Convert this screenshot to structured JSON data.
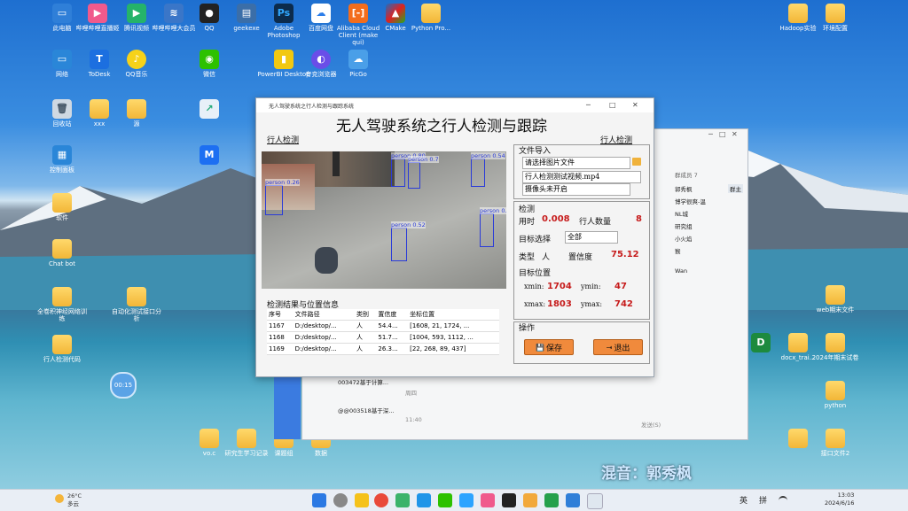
{
  "desktop": {
    "icons_top": [
      "此电脑",
      "哔哩哔哩直播姬",
      "腾讯视频",
      "哔哩哔哩大会员",
      "QQ",
      "geekexe",
      "Adobe Photoshop",
      "百度网盘",
      "Alibaba Cloud Client (make qui)",
      "CMake",
      "Python Pro...",
      "Hadoop实验",
      "环境配置"
    ],
    "icons_row2": [
      "网络",
      "ToDesk",
      "QQ音乐",
      "微信",
      "PowerBI Desktop",
      "夸克浏览器",
      "PicGo"
    ],
    "icons_row3": [
      "回收站",
      "xxx",
      "源"
    ],
    "icons_left": [
      "控制面板",
      "软件",
      "Chat bot",
      "全卷积神经网络训练",
      "行人检测代码"
    ],
    "icons_mid": [
      "自动化测试接口分析"
    ],
    "icons_bottom": [
      "vo.c",
      "研究生学习记录",
      "课题组",
      "数据"
    ],
    "icons_right": [
      "web期末文件",
      "docx_trai...",
      "2024年期末试卷",
      "python",
      "接口文件2"
    ],
    "clock_badge": "00:15"
  },
  "watermark": "混音：郭秀枫",
  "app": {
    "window_title": "无人驾驶系统之行人检测与跟踪系统",
    "big_title": "无人驾驶系统之行人检测与跟踪",
    "left_label": "行人检测",
    "right_label": "行人检测",
    "file_import_label": "文件导入",
    "image_placeholder": "请选择图片文件",
    "video_value": "行人检测测试视频.mp4",
    "camera_value": "摄像头未开启",
    "detection_label": "检测",
    "time_label": "用时",
    "time_value": "0.008",
    "count_label": "行人数量",
    "count_value": "8",
    "target_label": "目标选择",
    "target_select": "全部",
    "type_label": "类型",
    "type_value": "人",
    "confidence_label": "置信度",
    "confidence_value": "75.12",
    "position_label": "目标位置",
    "xmin_label": "xmin:",
    "xmin_value": "1704",
    "ymin_label": "ymin:",
    "ymin_value": "47",
    "xmax_label": "xmax:",
    "xmax_value": "1803",
    "ymax_label": "ymax:",
    "ymax_value": "742",
    "op_label": "操作",
    "save_label": "保存",
    "exit_label": "退出",
    "result_label": "检测结果与位置信息",
    "table_headers": [
      "序号",
      "文件路径",
      "类别",
      "置信度",
      "坐标位置"
    ],
    "table_rows": [
      [
        "1167",
        "D:/desktop/...",
        "人",
        "54.4...",
        "[1608, 21, 1724, ..."
      ],
      [
        "1168",
        "D:/desktop/...",
        "人",
        "51.7...",
        "[1004, 593, 1112, ..."
      ],
      [
        "1169",
        "D:/desktop/...",
        "人",
        "26.3...",
        "[22, 268, 89, 437]"
      ]
    ],
    "detections": [
      "person 0.26",
      "person 0.80",
      "person 0.7",
      "person 0.54",
      "person 0.52",
      "person 0.48",
      "person 0.9"
    ]
  },
  "chat": {
    "group_header": "群成员 7",
    "members": [
      "郭秀枫",
      "博学很爽-温",
      "NL城",
      "研究组",
      "小火焰",
      "猴"
    ],
    "tag": "群主",
    "sub": "Wan",
    "list": [
      {
        "name": "003472基于计算...",
        "time": "周四"
      },
      {
        "name": "@@003518基于深...",
        "time": "11:40"
      }
    ],
    "send": "发送(S)"
  },
  "taskbar": {
    "weather_temp": "26°C",
    "weather_text": "多云",
    "ime": "英",
    "ime2": "拼",
    "time": "13:03",
    "date": "2024/6/16"
  }
}
